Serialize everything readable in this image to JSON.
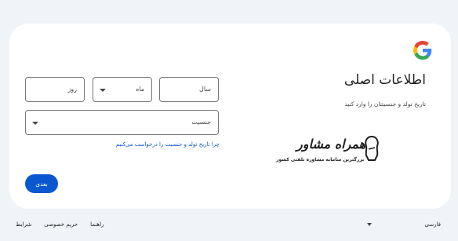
{
  "card": {
    "title": "اطلاعات اصلی",
    "subtitle": "تاریخ تولد و جنسیتتان را وارد کنید"
  },
  "form": {
    "year_label": "سال",
    "month_label": "ماه",
    "day_label": "روز",
    "gender_label": "جنسیت",
    "why_link": "چرا تاریخ تولد و جنسیت را درخواست می‌کنیم",
    "next_label": "بعدی"
  },
  "watermark": {
    "line1": "همراه مشاور",
    "line2": "بزرگترین سامانه مشاوره تلفنی کشور"
  },
  "footer": {
    "language": "فارسی",
    "help": "راهنما",
    "privacy": "حریم خصوصی",
    "terms": "شرایط"
  },
  "colors": {
    "primary": "#0b57d0",
    "background": "#f0f4f9",
    "card": "#ffffff"
  },
  "icons": {
    "logo": "google-g-logo-icon",
    "dropdown": "caret-down-icon"
  }
}
